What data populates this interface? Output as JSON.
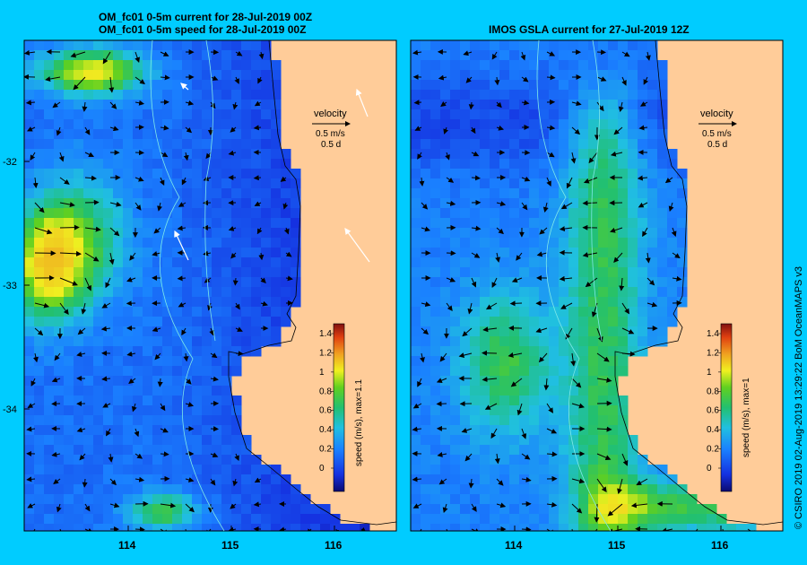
{
  "left_panel": {
    "title_line1": "OM_fc01 0-5m current for 28-Jul-2019 00Z",
    "title_line2": "OM_fc01 0-5m speed for 28-Jul-2019 00Z",
    "velocity_label": "velocity",
    "velocity_scale": "0.5 m/s",
    "velocity_time": "0.5 d",
    "colorbar_label": "speed (m/s), max=1.1",
    "colorbar_ticks": [
      "0",
      "0.2",
      "0.4",
      "0.6",
      "0.8",
      "1",
      "1.2",
      "1.4"
    ],
    "lat_ticks": [
      "-32",
      "-33",
      "-34"
    ],
    "lon_ticks": [
      "114",
      "115",
      "116"
    ]
  },
  "right_panel": {
    "title": "IMOS GSLA current for 27-Jul-2019 12Z",
    "velocity_label": "velocity",
    "velocity_scale": "0.5 m/s",
    "velocity_time": "0.5 d",
    "colorbar_label": "speed (m/s), max=1",
    "colorbar_ticks": [
      "0",
      "0.2",
      "0.4",
      "0.6",
      "0.8",
      "1",
      "1.2",
      "1.4"
    ],
    "lon_ticks": [
      "114",
      "115",
      "116"
    ]
  },
  "credit": "© CSIRO 2019   02-Aug-2019 13:29:22 BoM OceanMAPS v3",
  "colors": {
    "background": "#00ccff",
    "land": "#ffcc99",
    "low": "#1a2ad8",
    "mid": "#1fb0a0",
    "high": "#f0e020"
  },
  "map_extent": {
    "lon": [
      113,
      116.6
    ],
    "lat": [
      -35,
      -31.6
    ]
  }
}
